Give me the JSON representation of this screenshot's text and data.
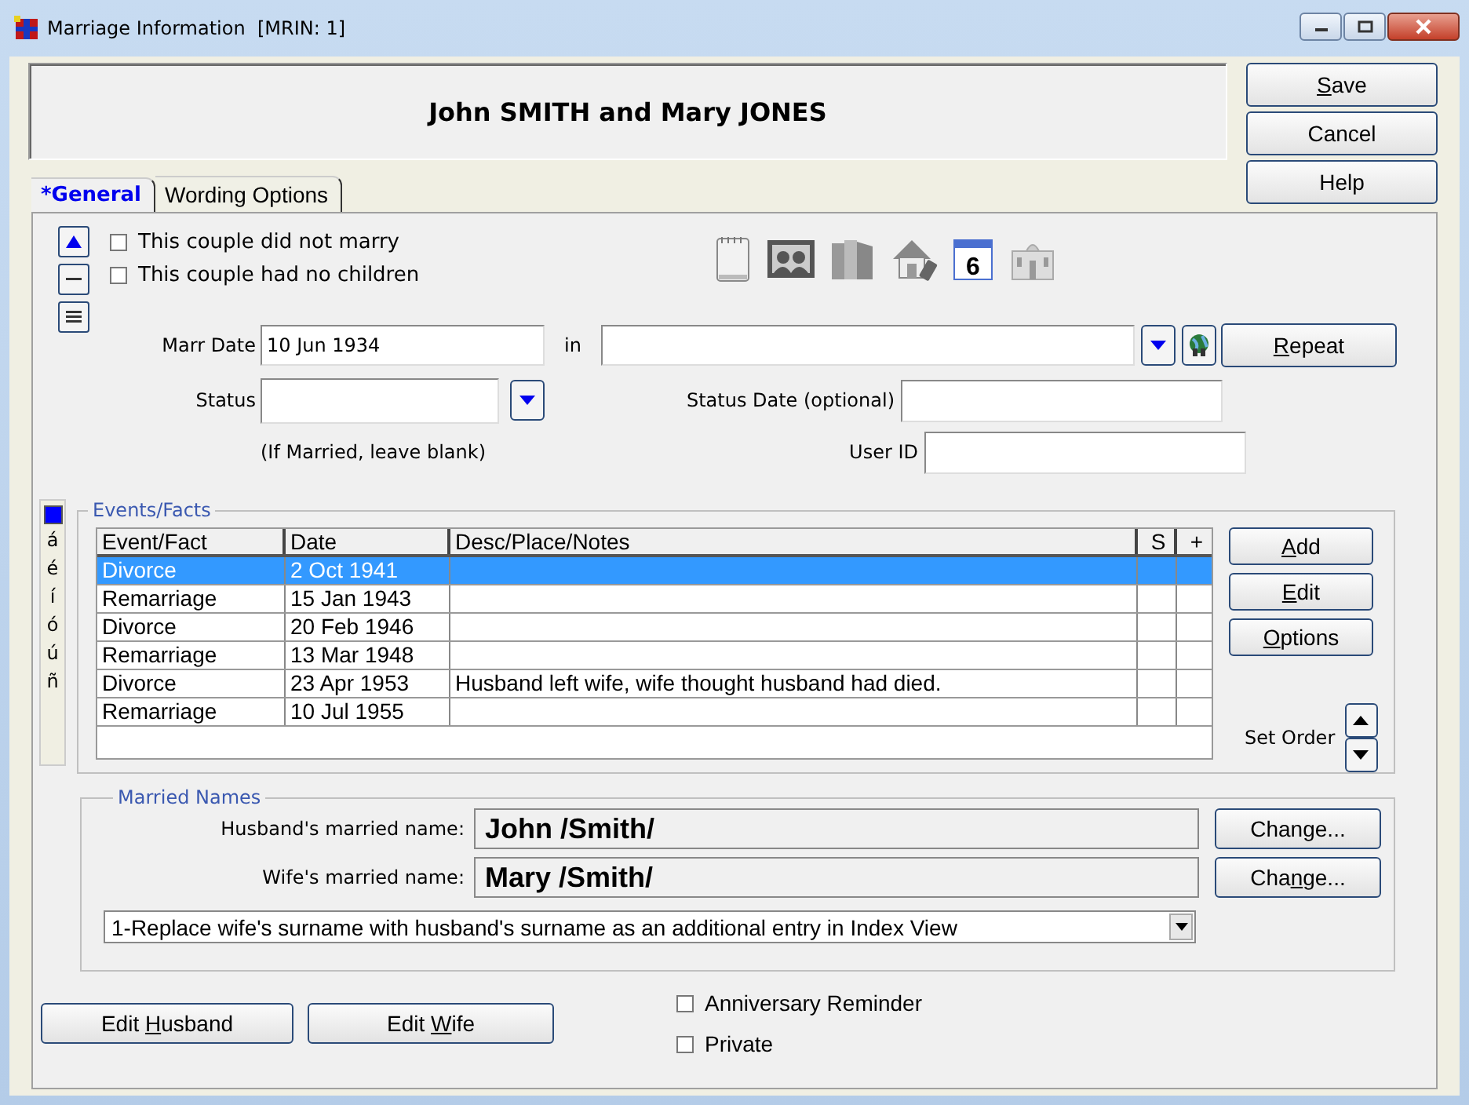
{
  "window": {
    "title": "Marriage Information  [MRIN: 1]"
  },
  "header": {
    "couple": "John SMITH and Mary JONES"
  },
  "dialog_buttons": [
    {
      "key": "S",
      "after": "ave"
    },
    {
      "label": "Cancel"
    },
    {
      "label": "Help"
    }
  ],
  "tabs": [
    {
      "label": "*General",
      "selected": true
    },
    {
      "label": "Wording Options",
      "selected": false
    }
  ],
  "flags": [
    {
      "label": "This couple did not marry",
      "checked": false
    },
    {
      "label": "This couple had no children",
      "checked": false
    }
  ],
  "toolbar": [
    {
      "kind": "notes"
    },
    {
      "kind": "photos"
    },
    {
      "kind": "books"
    },
    {
      "kind": "home"
    },
    {
      "kind": "calendar",
      "day": "6"
    },
    {
      "kind": "building"
    }
  ],
  "marr_date": {
    "label": "Marr Date",
    "value": "10 Jun 1934"
  },
  "place": {
    "label": "in"
  },
  "repeat_button": {
    "key": "R",
    "after": "epeat"
  },
  "status": {
    "label": "Status",
    "hint": "(If Married, leave blank)"
  },
  "status_date": {
    "label": "Status Date (optional)"
  },
  "user_id": {
    "label": "User ID"
  },
  "accents": [
    "á",
    "é",
    "í",
    "ó",
    "ú",
    "ñ"
  ],
  "events": {
    "title": "Events/Facts",
    "columns": [
      "Event/Fact",
      "Date",
      "Desc/Place/Notes",
      "S",
      "+"
    ],
    "rows": [
      {
        "event": "Divorce",
        "date": "2 Oct 1941",
        "selected": true
      },
      {
        "event": "Remarriage",
        "date": "15 Jan 1943",
        "selected": false
      },
      {
        "event": "Divorce",
        "date": "20 Feb 1946",
        "selected": false
      },
      {
        "event": "Remarriage",
        "date": "13 Mar 1948",
        "selected": false
      },
      {
        "event": "Divorce",
        "date": "23 Apr 1953",
        "notes": "Husband left wife, wife thought husband had died.",
        "selected": false
      },
      {
        "event": "Remarriage",
        "date": "10 Jul 1955",
        "selected": false
      }
    ],
    "buttons": [
      {
        "key": "A",
        "after": "dd"
      },
      {
        "key": "E",
        "after": "dit"
      },
      {
        "key": "O",
        "after": "ptions"
      }
    ],
    "set_order": "Set Order"
  },
  "married_names": {
    "title": "Married Names",
    "names": [
      {
        "label": "Husband's married name:",
        "value": "John /Smith/",
        "button": {
          "before": "Chan",
          "key": "g",
          "after": "e..."
        }
      },
      {
        "label": "Wife's married name:",
        "value": "Mary /Smith/",
        "button": {
          "before": "Cha",
          "key": "n",
          "after": "ge..."
        }
      }
    ],
    "option": "1-Replace wife's surname with husband's surname as an additional entry in Index View"
  },
  "bottom_buttons": [
    {
      "before": "Edit ",
      "key": "H",
      "after": "usband"
    },
    {
      "before": "Edit ",
      "key": "W",
      "after": "ife"
    }
  ],
  "bottom_flags": [
    {
      "label": "Anniversary Reminder",
      "checked": false
    },
    {
      "label": "Private",
      "checked": false
    }
  ]
}
